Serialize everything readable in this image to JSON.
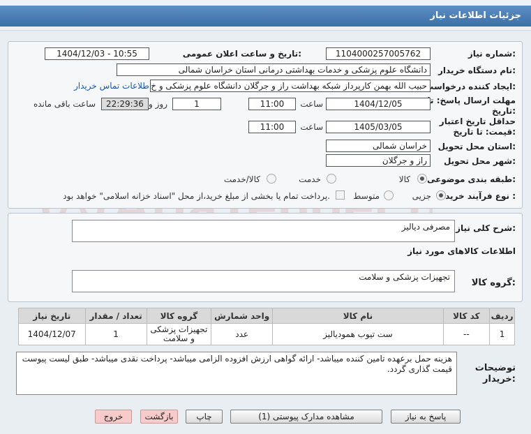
{
  "header": {
    "title": "جزئیات اطلاعات نیاز"
  },
  "form": {
    "need_number_label": "شماره نیاز:",
    "need_number": "1104000257005762",
    "announce_label": "تاریخ و ساعت اعلان عمومی:",
    "announce_value": "1404/12/03 - 10:55",
    "buyer_label": "نام دستگاه خریدار:",
    "buyer_value": "دانشگاه علوم پزشکی و خدمات بهداشتی درمانی استان خراسان شمالی",
    "creator_label": "ایجاد کننده درخواست:",
    "creator_value": "حبیب الله بهمن کارپرداز شبکه بهداشت راز و جرگلان دانشگاه علوم پزشکی و خ",
    "contact_link": "اطلاعات تماس خریدار",
    "deadline_label_1": "مهلت ارسال پاسخ: تا",
    "deadline_label_2": "تاریخ:",
    "deadline_date": "1404/12/05",
    "time_label": "ساعت",
    "deadline_time": "11:00",
    "days_value": "1",
    "days_label": "روز و",
    "remaining_time": "22:29:36",
    "remaining_label": "ساعت باقی مانده",
    "validity_label_1": "حداقل تاریخ اعتبار",
    "validity_label_2": "قیمت: تا تاریخ:",
    "validity_date": "1405/03/05",
    "validity_time": "11:00",
    "province_label": "استان محل تحویل:",
    "province_value": "خراسان شمالی",
    "city_label": "شهر محل تحویل:",
    "city_value": "راز و جرگلان",
    "category_label": "طبقه بندی موضوعی:",
    "category_options": [
      "کالا",
      "خدمت",
      "کالا/خدمت"
    ],
    "process_label": "نوع فرآیند خرید :",
    "process_options": [
      "جزیی",
      "متوسط"
    ],
    "payment_note": "پرداخت تمام یا بخشی از مبلغ خرید،از محل \"اسناد خزانه اسلامی\" خواهد بود."
  },
  "summary": {
    "label": "شرح کلی نیاز:",
    "value": "مصرفی دیالیز",
    "goods_info_title": "اطلاعات کالاهای مورد نیاز",
    "group_label": "گروه کالا:",
    "group_value": "تجهیزات پزشکی و سلامت"
  },
  "table": {
    "headers": [
      "ردیف",
      "کد کالا",
      "نام کالا",
      "واحد شمارش",
      "گروه کالا",
      "تعداد / مقدار",
      "تاریخ نیاز"
    ],
    "rows": [
      [
        "1",
        "--",
        "ست تیوب همودیالیز",
        "عدد",
        "تجهیزات پزشکی و سلامت",
        "1",
        "1404/12/07"
      ]
    ]
  },
  "notes": {
    "label_1": "توضیحات",
    "label_2": "خریدار:",
    "value": "هزینه حمل برعهده تامین کننده میباشد- ارائه گواهی ارزش افزوده الزامی میباشد- پرداخت نقدی میباشد- طبق لیست پیوست قیمت گذاری گردد."
  },
  "buttons": {
    "reply": "پاسخ به نیاز",
    "attachments": "مشاهده مدارک پیوستی (1)",
    "print": "چاپ",
    "back": "بازگشت",
    "exit": "خروج"
  },
  "colors": {
    "title_bar": "#4a7db4",
    "link": "#1a56a8",
    "pink_button": "#f9caca"
  }
}
